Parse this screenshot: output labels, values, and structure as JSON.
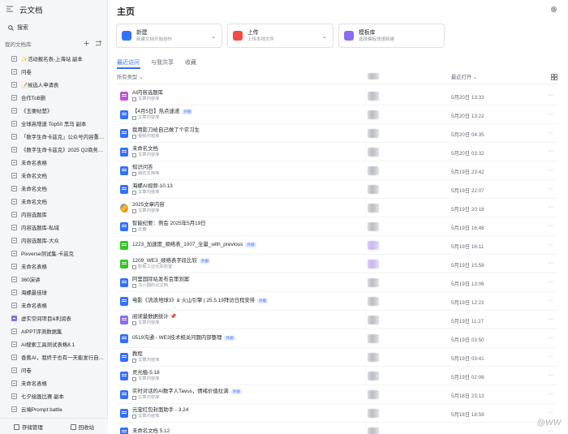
{
  "app": {
    "title": "云文档"
  },
  "sidebar": {
    "search_label": "搜索",
    "section_label": "我的文档库",
    "items": [
      {
        "label": "✨活动报名表-上海站 副本",
        "icon": "doc"
      },
      {
        "label": "问卷",
        "icon": "doc"
      },
      {
        "label": "📝候选人申请表",
        "icon": "doc"
      },
      {
        "label": "合作ToB删",
        "icon": "doc"
      },
      {
        "label": "《玉栗帖楚》",
        "icon": "doc"
      },
      {
        "label": "全球高增速 Top50 黑马 副本",
        "icon": "sheet"
      },
      {
        "label": "「数字生命卡兹克」公众号内容重…",
        "icon": "doc"
      },
      {
        "label": "《数字生命卡兹克》2025 Q2商务…",
        "icon": "doc"
      },
      {
        "label": "未命名表格",
        "icon": "sheet"
      },
      {
        "label": "未命名文档",
        "icon": "doc"
      },
      {
        "label": "未命名文档",
        "icon": "doc"
      },
      {
        "label": "未命名文档",
        "icon": "doc"
      },
      {
        "label": "内容选题库",
        "icon": "sheet"
      },
      {
        "label": "内容选题库-私域",
        "icon": "sheet"
      },
      {
        "label": "内容选题库-大众",
        "icon": "sheet"
      },
      {
        "label": "Pixverse测试集-卡兹克",
        "icon": "doc"
      },
      {
        "label": "未命名表格",
        "icon": "sheet"
      },
      {
        "label": "360演讲",
        "icon": "doc"
      },
      {
        "label": "海螺最佳球",
        "icon": "doc"
      },
      {
        "label": "未命名表格",
        "icon": "sheet"
      },
      {
        "label": "虚实空间项目&利润表",
        "icon": "purple"
      },
      {
        "label": "AIPPT评测数据集",
        "icon": "doc"
      },
      {
        "label": "AI搜索工具测试表格8.1",
        "icon": "doc"
      },
      {
        "label": "香蕉AI，我终于也有一天能发行自…",
        "icon": "doc"
      },
      {
        "label": "问卷",
        "icon": "doc"
      },
      {
        "label": "未命名表格",
        "icon": "sheet"
      },
      {
        "label": "七夕绘画比赛 副本",
        "icon": "doc"
      },
      {
        "label": "云端Prompt battle",
        "icon": "doc"
      }
    ],
    "storage_label": "存储管理",
    "trash_label": "回收站"
  },
  "main": {
    "title": "主页",
    "cards": [
      {
        "title": "新建",
        "subtitle": "新建文档开始协作",
        "color": "#3370ff"
      },
      {
        "title": "上传",
        "subtitle": "上传本地文件",
        "color": "#f54a45"
      },
      {
        "title": "模板库",
        "subtitle": "选择模板快速新建",
        "color": "#8c6cf0"
      }
    ],
    "tabs": [
      "最近访问",
      "与我共享",
      "收藏"
    ],
    "filter_label": "所有类型",
    "sort_label": "最近打开",
    "rows": [
      {
        "name": "AI内容选题库",
        "sub": "文章内容库",
        "date": "5月20日 13:33",
        "icon": "ai",
        "badge": ""
      },
      {
        "name": "【4月5日】热点速递",
        "sub": "文章内容库",
        "date": "5月20日 13:22",
        "icon": "doc",
        "badge": "外部"
      },
      {
        "name": "我用影刀给自己做了个实习生",
        "sub": "视频内容库",
        "date": "5月20日 04:35",
        "icon": "doc",
        "badge": ""
      },
      {
        "name": "未命名文档",
        "sub": "文章内容库",
        "date": "5月20日 03:32",
        "icon": "doc",
        "badge": ""
      },
      {
        "name": "知识问答",
        "sub": "我的文档库",
        "date": "5月19日 23:42",
        "icon": "doc",
        "badge": ""
      },
      {
        "name": "海螺AI视频-10.13",
        "sub": "文章内容库",
        "date": "5月19日 22:07",
        "icon": "doc",
        "badge": ""
      },
      {
        "name": "2025文章内容",
        "sub": "文章内容库",
        "date": "5月19日 20:18",
        "icon": "cloud",
        "badge": ""
      },
      {
        "name": "智能纪要：例会 2025年5月19日",
        "sub": "云盘",
        "date": "5月19日 16:48",
        "icon": "doc",
        "badge": ""
      },
      {
        "name": "1223_加速度_顺络表_1007_全量_with_previous",
        "sub": "",
        "date": "5月19日 16:11",
        "icon": "sheet",
        "badge": "外部"
      },
      {
        "name": "1209_WE3_顺络表字段比较",
        "sub": "影视工业化实验室",
        "date": "5月19日 15:58",
        "icon": "sheet",
        "badge": "外部"
      },
      {
        "name": "阿里国际站发布会策划案",
        "sub": "马小圆的云文档",
        "date": "5月19日 13:06",
        "icon": "doc",
        "badge": ""
      },
      {
        "name": "电影《流浪地球3》& 火山引擎 | 25.5.19拜访日程安排",
        "sub": "",
        "date": "5月19日 12:22",
        "icon": "doc",
        "badge": "外部"
      },
      {
        "name": "阅读量数据统计 📌",
        "sub": "文章内容库",
        "date": "5月19日 11:27",
        "icon": "board",
        "badge": ""
      },
      {
        "name": "0519沟通 - WE3技术相关问题内部整理",
        "sub": "",
        "date": "5月19日 03:50",
        "icon": "doc",
        "badge": "外部"
      },
      {
        "name": "教程",
        "sub": "文章内容库",
        "date": "5月19日 03:41",
        "icon": "doc",
        "badge": ""
      },
      {
        "name": "灵光植-5.18",
        "sub": "文章内容库",
        "date": "5月19日 02:06",
        "icon": "doc",
        "badge": ""
      },
      {
        "name": "实时对话的AI数字人Tavus，情绪价值拉满",
        "sub": "文章内容库",
        "date": "5月18日 23:13",
        "icon": "doc",
        "badge": "外部"
      },
      {
        "name": "元宝红包封面助手 - 3.24",
        "sub": "文章内容库",
        "date": "5月18日 18:59",
        "icon": "doc",
        "badge": ""
      },
      {
        "name": "未命名文档 5.12",
        "sub": "",
        "date": "",
        "icon": "doc",
        "badge": ""
      }
    ]
  },
  "watermark": "@WW"
}
